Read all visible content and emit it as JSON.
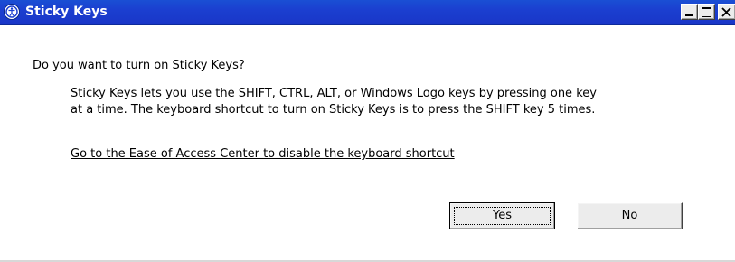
{
  "window": {
    "title": "Sticky Keys",
    "icon": "ease-of-access-icon",
    "controls": {
      "minimize": "minimize-icon",
      "maximize": "maximize-icon",
      "close": "close-icon"
    }
  },
  "dialog": {
    "question": "Do you want to turn on Sticky Keys?",
    "description_line1": "Sticky Keys lets you use the SHIFT, CTRL, ALT, or Windows Logo keys by pressing one key",
    "description_line2": "at a time. The keyboard shortcut to turn on Sticky Keys is to press the SHIFT key 5 times.",
    "link_text": "Go to the Ease of Access Center to disable the keyboard shortcut"
  },
  "buttons": {
    "yes_mnemonic": "Y",
    "yes_rest": "es",
    "no_mnemonic": "N",
    "no_rest": "o"
  },
  "colors": {
    "titlebar": "#1b3fd0",
    "background": "#ffffff",
    "button_face": "#ececec"
  }
}
